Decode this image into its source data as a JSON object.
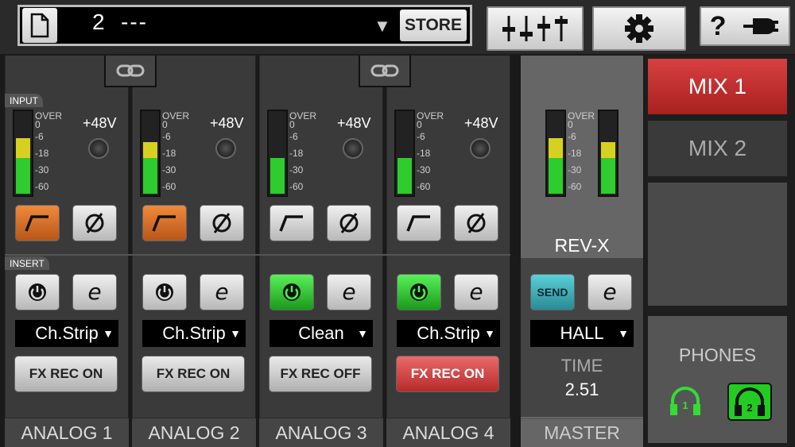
{
  "scene": {
    "number": "2",
    "name": "---",
    "store_label": "STORE"
  },
  "colors": {
    "accent_orange": "#e8801f",
    "on_green": "#33dd33",
    "mix_active": "#c83030",
    "send_cyan": "#3fb8c4",
    "fx_rec_on_red": "#d84848"
  },
  "sections": {
    "input": "INPUT",
    "insert": "INSERT"
  },
  "meter_scale": [
    "OVER",
    "0",
    "-6",
    "-18",
    "-30",
    "-60"
  ],
  "phantom_label": "+48V",
  "channels": [
    {
      "name": "ANALOG 1",
      "preset": "Ch.Strip",
      "fx_rec": "FX REC ON",
      "hpf_on": true,
      "insert_on": false,
      "level": 0.55,
      "peak": 0.7
    },
    {
      "name": "ANALOG 2",
      "preset": "Ch.Strip",
      "fx_rec": "FX REC ON",
      "hpf_on": true,
      "insert_on": false,
      "level": 0.55,
      "peak": 0.65
    },
    {
      "name": "ANALOG 3",
      "preset": "Clean",
      "fx_rec": "FX REC OFF",
      "hpf_on": false,
      "insert_on": true,
      "level": 0.45,
      "peak": 0.45
    },
    {
      "name": "ANALOG 4",
      "preset": "Ch.Strip",
      "fx_rec": "FX REC ON",
      "hpf_on": false,
      "insert_on": true,
      "level": 0.45,
      "peak": 0.45
    }
  ],
  "master": {
    "name": "MASTER",
    "effect": "REV-X",
    "send_label": "SEND",
    "reverb_type": "HALL",
    "time_label": "TIME",
    "time_value": "2.51",
    "level_l": 0.6,
    "peak_l": 0.7,
    "level_r": 0.6,
    "peak_r": 0.65
  },
  "mix": {
    "mix1": "MIX 1",
    "mix2": "MIX 2",
    "phones": "PHONES",
    "phones1_num": "1",
    "phones2_num": "2"
  }
}
